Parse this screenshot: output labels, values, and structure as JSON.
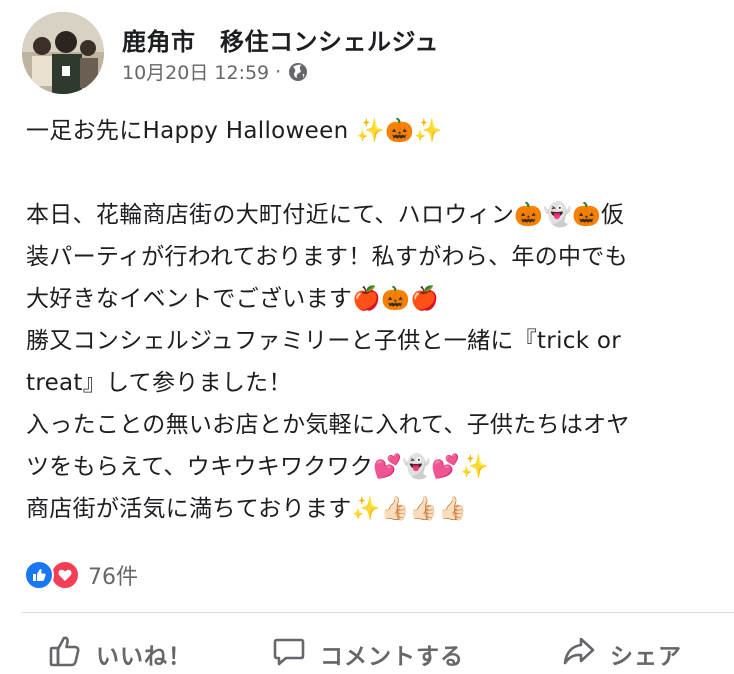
{
  "post": {
    "author": "鹿角市　移住コンシェルジュ",
    "timestamp": "10月20日 12:59",
    "separator": "·",
    "privacy_icon": "globe-icon",
    "lines": [
      "一足お先にHappy Halloween ✨🎃✨",
      "",
      "本日、花輪商店街の大町付近にて、ハロウィン🎃👻🎃仮",
      "装パーティが行われております！私すがわら、年の中でも",
      "大好きなイベントでございます🍎🎃🍎",
      "勝又コンシェルジュファミリーと子供と一緒に『trick or",
      "treat』して参りました！",
      "入ったことの無いお店とか気軽に入れて、子供たちはオヤ",
      "ツをもらえて、ウキウキワクワク💕👻💕✨",
      "商店街が活気に満ちております✨👍🏻👍🏻👍🏻"
    ]
  },
  "reactions": {
    "types": [
      "like",
      "love"
    ],
    "count": "76件"
  },
  "actions": {
    "like_label": "いいね！",
    "comment_label": "コメントする",
    "share_label": "シェア"
  },
  "colors": {
    "like_blue": "#1877f2",
    "love_red": "#f33e58",
    "secondary_text": "#65676b"
  }
}
